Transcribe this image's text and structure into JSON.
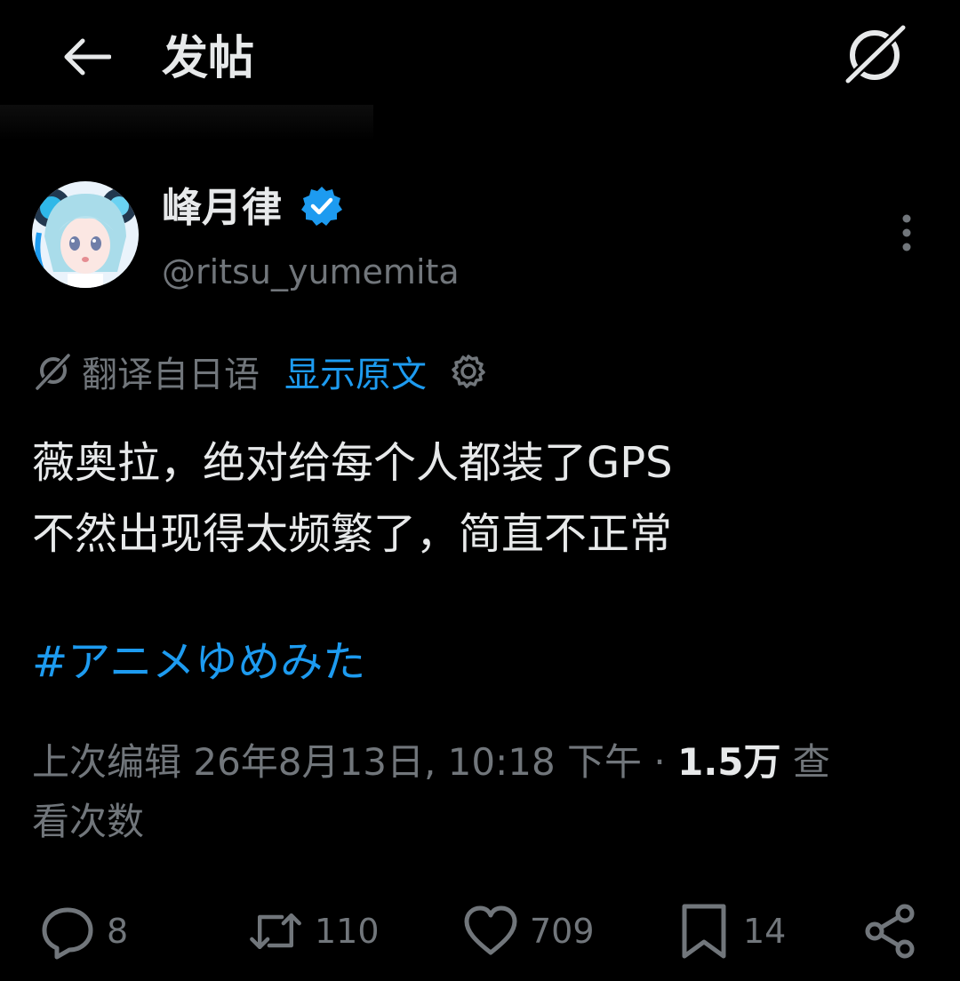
{
  "header": {
    "title": "发帖",
    "back_icon": "arrow-left-icon",
    "grok_icon": "grok-icon"
  },
  "author": {
    "display_name": "峰月律",
    "handle": "@ritsu_yumemita",
    "verified": true,
    "verified_color": "#1d9bf0"
  },
  "translation": {
    "label": "翻译自日语",
    "show_original": "显示原文"
  },
  "post": {
    "lines": [
      "薇奥拉，绝对给每个人都装了GPS",
      "不然出现得太频繁了，简直不正常"
    ],
    "hashtag": "#アニメゆめみた"
  },
  "meta": {
    "prefix": "上次编辑 26年8月13日, 10:18 下午 · ",
    "views": "1.5万",
    "suffix_line1": " 查",
    "suffix_line2": "看次数"
  },
  "actions": {
    "reply_count": "8",
    "repost_count": "110",
    "like_count": "709",
    "bookmark_count": "14"
  },
  "colors": {
    "background": "#000000",
    "text": "#e7e9ea",
    "muted": "#71767b",
    "accent": "#1d9bf0"
  }
}
